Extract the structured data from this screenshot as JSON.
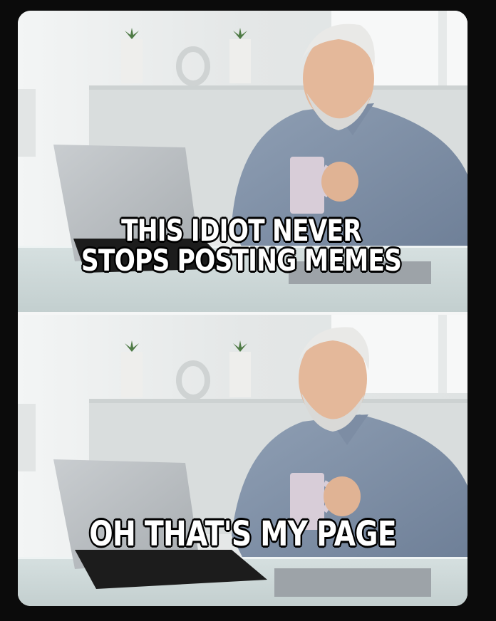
{
  "meme": {
    "top_caption": {
      "line1": "THIS IDIOT NEVER",
      "line2": "STOPS POSTING MEMES"
    },
    "bottom_caption": "OH THAT'S MY PAGE"
  }
}
